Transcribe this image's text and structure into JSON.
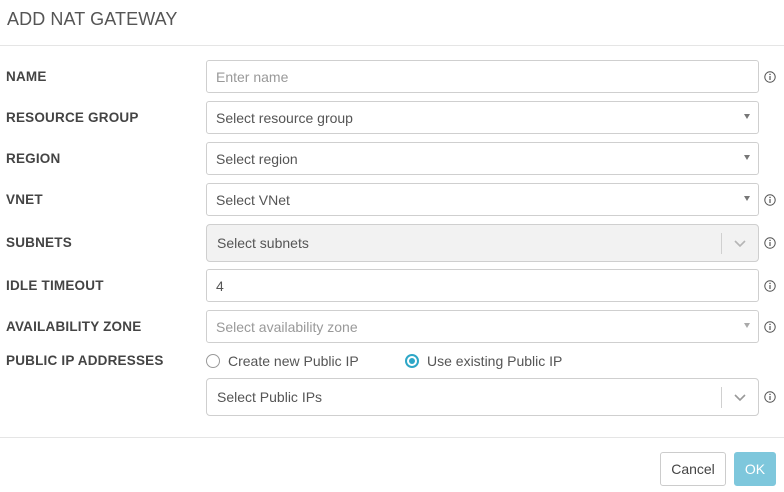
{
  "dialog": {
    "title": "ADD NAT GATEWAY"
  },
  "form": {
    "name": {
      "label": "NAME",
      "placeholder": "Enter name"
    },
    "resource_group": {
      "label": "RESOURCE GROUP",
      "placeholder": "Select resource group"
    },
    "region": {
      "label": "REGION",
      "placeholder": "Select region"
    },
    "vnet": {
      "label": "VNET",
      "placeholder": "Select VNet"
    },
    "subnets": {
      "label": "SUBNETS",
      "placeholder": "Select subnets"
    },
    "idle_timeout": {
      "label": "IDLE TIMEOUT",
      "value": "4"
    },
    "availability_zone": {
      "label": "AVAILABILITY ZONE",
      "placeholder": "Select availability zone"
    },
    "public_ip": {
      "label": "PUBLIC IP ADDRESSES",
      "option_create": "Create new Public IP",
      "option_existing": "Use existing Public IP",
      "selected": "existing",
      "select_placeholder": "Select Public IPs"
    }
  },
  "footer": {
    "cancel_label": "Cancel",
    "ok_label": "OK"
  },
  "colors": {
    "accent": "#2ea7c7",
    "ok_button": "#7ec7dc"
  },
  "icons": {
    "info": "info-circle-icon",
    "caret": "caret-down-icon",
    "chevron": "chevron-down-icon"
  }
}
